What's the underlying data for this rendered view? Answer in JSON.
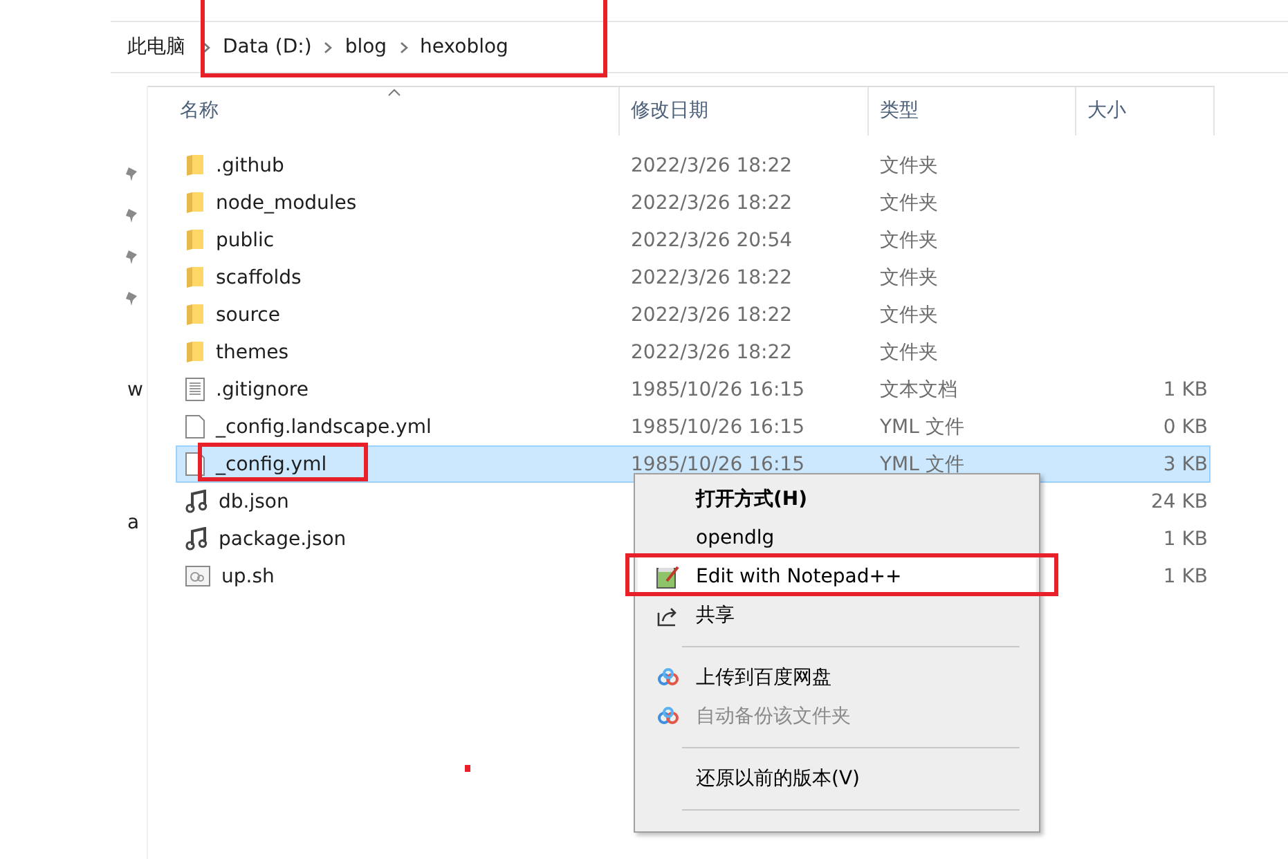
{
  "breadcrumb": [
    {
      "label": "此电脑"
    },
    {
      "label": "Data (D:)"
    },
    {
      "label": "blog"
    },
    {
      "label": "hexoblog"
    }
  ],
  "nav_pane": {
    "items": [
      {
        "kind": "pin"
      },
      {
        "kind": "pin"
      },
      {
        "kind": "pin"
      },
      {
        "kind": "pin"
      },
      {
        "kind": "text",
        "label": "w"
      },
      {
        "kind": "text",
        "label": "a"
      }
    ]
  },
  "table": {
    "columns": [
      "名称",
      "修改日期",
      "类型",
      "大小"
    ],
    "rows": [
      {
        "name": ".github",
        "kind": "folder",
        "modified": "2022/3/26 18:22",
        "type": "文件夹",
        "size": "",
        "selected": false
      },
      {
        "name": "node_modules",
        "kind": "folder",
        "modified": "2022/3/26 18:22",
        "type": "文件夹",
        "size": "",
        "selected": false
      },
      {
        "name": "public",
        "kind": "folder",
        "modified": "2022/3/26 20:54",
        "type": "文件夹",
        "size": "",
        "selected": false
      },
      {
        "name": "scaffolds",
        "kind": "folder",
        "modified": "2022/3/26 18:22",
        "type": "文件夹",
        "size": "",
        "selected": false
      },
      {
        "name": "source",
        "kind": "folder",
        "modified": "2022/3/26 18:22",
        "type": "文件夹",
        "size": "",
        "selected": false
      },
      {
        "name": "themes",
        "kind": "folder",
        "modified": "2022/3/26 18:22",
        "type": "文件夹",
        "size": "",
        "selected": false
      },
      {
        "name": ".gitignore",
        "kind": "text",
        "modified": "1985/10/26 16:15",
        "type": "文本文档",
        "size": "1 KB",
        "selected": false
      },
      {
        "name": "_config.landscape.yml",
        "kind": "blank",
        "modified": "1985/10/26 16:15",
        "type": "YML 文件",
        "size": "0 KB",
        "selected": false
      },
      {
        "name": "_config.yml",
        "kind": "blank",
        "modified": "1985/10/26 16:15",
        "type": "YML 文件",
        "size": "3 KB",
        "selected": true
      },
      {
        "name": "db.json",
        "kind": "json",
        "size": "24 KB",
        "selected": false
      },
      {
        "name": "package.json",
        "kind": "json",
        "size": "1 KB",
        "selected": false
      },
      {
        "name": "up.sh",
        "kind": "script",
        "size": "1 KB",
        "selected": false
      }
    ]
  },
  "context_menu": {
    "items": [
      {
        "kind": "plain",
        "label": "打开方式(H)",
        "bold": true,
        "disabled": false,
        "selected": false
      },
      {
        "kind": "plain",
        "label": "opendlg",
        "bold": false,
        "disabled": false,
        "selected": false
      },
      {
        "kind": "notepad",
        "label": "Edit with Notepad++",
        "bold": false,
        "disabled": false,
        "selected": true
      },
      {
        "kind": "share",
        "label": "共享",
        "bold": false,
        "disabled": false,
        "selected": false
      },
      {
        "kind": "separator"
      },
      {
        "kind": "cloud",
        "label": "上传到百度网盘",
        "bold": false,
        "disabled": false,
        "selected": false
      },
      {
        "kind": "cloud",
        "label": "自动备份该文件夹",
        "bold": false,
        "disabled": true,
        "selected": false
      },
      {
        "kind": "separator"
      },
      {
        "kind": "plain",
        "label": "还原以前的版本(V)",
        "bold": false,
        "disabled": false,
        "selected": false
      },
      {
        "kind": "separator"
      }
    ]
  }
}
